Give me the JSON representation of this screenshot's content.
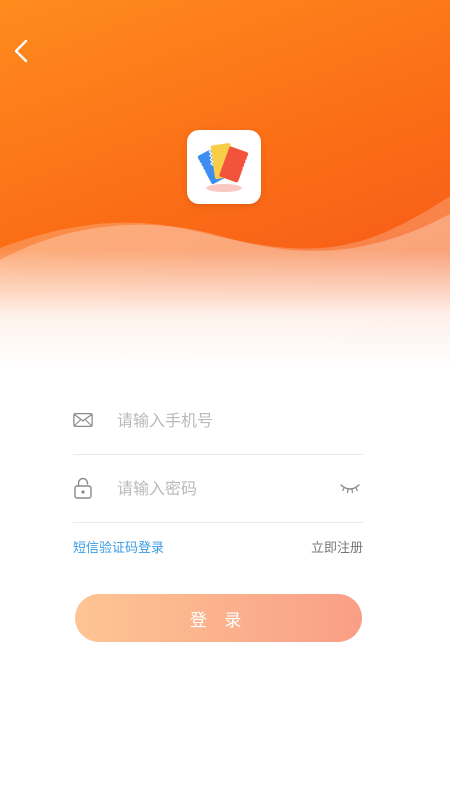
{
  "colors": {
    "header_start": "#ff8b1e",
    "header_end": "#f4521a",
    "link_blue": "#3a9be3",
    "button_start": "#fec593",
    "button_end": "#f99e86"
  },
  "header": {
    "back_icon": "chevron-left-icon",
    "logo_icon": "tickets-logo-icon"
  },
  "form": {
    "phone": {
      "icon": "mail-icon",
      "placeholder": "请输入手机号",
      "value": ""
    },
    "password": {
      "icon": "unlock-icon",
      "placeholder": "请输入密码",
      "value": "",
      "visibility_icon": "eye-closed-icon"
    }
  },
  "links": {
    "sms_login": "短信验证码登录",
    "register": "立即注册"
  },
  "login_button": "登 录"
}
